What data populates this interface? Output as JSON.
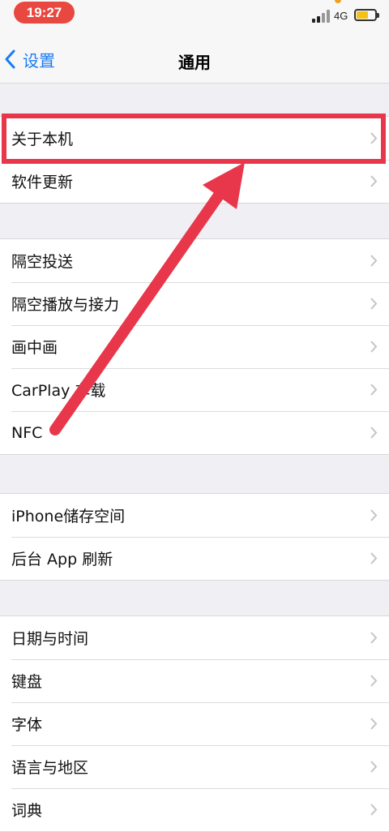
{
  "status_bar": {
    "time": "19:27",
    "network": "4G",
    "icons": [
      "signal-icon",
      "battery-icon"
    ]
  },
  "nav": {
    "back_label": "设置",
    "title": "通用",
    "icons": [
      "chevron-left-icon"
    ]
  },
  "groups": [
    {
      "items": [
        {
          "label": "关于本机"
        },
        {
          "label": "软件更新"
        }
      ]
    },
    {
      "items": [
        {
          "label": "隔空投送"
        },
        {
          "label": "隔空播放与接力"
        },
        {
          "label": "画中画"
        },
        {
          "label": "CarPlay 车载"
        },
        {
          "label": "NFC"
        }
      ]
    },
    {
      "items": [
        {
          "label": "iPhone储存空间"
        },
        {
          "label": "后台 App 刷新"
        }
      ]
    },
    {
      "items": [
        {
          "label": "日期与时间"
        },
        {
          "label": "键盘"
        },
        {
          "label": "字体"
        },
        {
          "label": "语言与地区"
        },
        {
          "label": "词典"
        }
      ]
    }
  ],
  "colors": {
    "accent": "#1a7cf5",
    "annotation": "#e8374a",
    "time_pill": "#e8483f",
    "background": "#efeff4"
  },
  "row_icon": "chevron-right-icon"
}
